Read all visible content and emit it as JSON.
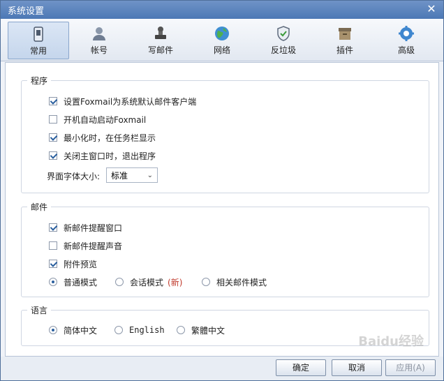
{
  "window": {
    "title": "系统设置",
    "close_glyph": "✕"
  },
  "tabs": [
    {
      "label": "常用",
      "icon": "phone-icon"
    },
    {
      "label": "帐号",
      "icon": "user-icon"
    },
    {
      "label": "写邮件",
      "icon": "stamp-icon"
    },
    {
      "label": "网络",
      "icon": "globe-icon"
    },
    {
      "label": "反垃圾",
      "icon": "shield-icon"
    },
    {
      "label": "插件",
      "icon": "box-icon"
    },
    {
      "label": "高级",
      "icon": "gear-icon"
    }
  ],
  "program": {
    "title": "程序",
    "options": [
      {
        "label": "设置Foxmail为系统默认邮件客户端",
        "checked": true
      },
      {
        "label": "开机自动启动Foxmail",
        "checked": false
      },
      {
        "label": "最小化时，在任务栏显示",
        "checked": true
      },
      {
        "label": "关闭主窗口时，退出程序",
        "checked": true
      }
    ],
    "font_size_label": "界面字体大小:",
    "font_size_value": "标准"
  },
  "mail": {
    "title": "邮件",
    "options": [
      {
        "label": "新邮件提醒窗口",
        "checked": true
      },
      {
        "label": "新邮件提醒声音",
        "checked": false
      },
      {
        "label": "附件预览",
        "checked": true
      }
    ],
    "modes": [
      {
        "label": "普通模式",
        "selected": true
      },
      {
        "label": "会话模式",
        "selected": false,
        "badge": "(新)"
      },
      {
        "label": "相关邮件模式",
        "selected": false
      }
    ]
  },
  "language": {
    "title": "语言",
    "options": [
      {
        "label": "简体中文",
        "selected": true
      },
      {
        "label": "English",
        "selected": false
      },
      {
        "label": "繁體中文",
        "selected": false
      }
    ]
  },
  "buttons": {
    "ok": "确定",
    "cancel": "取消",
    "apply": "应用(A)"
  },
  "watermark": "Baidu经验"
}
